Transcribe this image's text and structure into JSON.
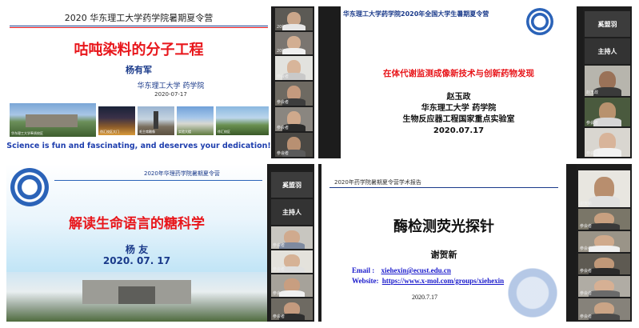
{
  "panel1": {
    "header": "2020 华东理工大学药学院暑期夏令营",
    "title": "咕吨染料的分子工程",
    "speaker": "杨有军",
    "affiliation": "华东理工大学    药学院",
    "date": "2020-07-17",
    "photos": [
      {
        "caption": "华东理工大学奉贤校区"
      },
      {
        "caption": "徐汇校区大门"
      },
      {
        "caption": "毛主席雕像"
      },
      {
        "caption": "实验大楼"
      },
      {
        "caption": "徐汇校区"
      }
    ],
    "motto": "Science is fun and fascinating, and deserves your dedication!",
    "participants": [
      {
        "name": "20级..."
      },
      {
        "name": "20级..."
      },
      {
        "name": "参会者"
      },
      {
        "name": "参会者"
      },
      {
        "name": "参会者"
      },
      {
        "name": "参会者"
      }
    ]
  },
  "panel2": {
    "header": "华东理工大学药学院2020年全国大学生暑期夏令营",
    "title": "在体代谢监测成像新技术与创新药物发现",
    "speaker": "赵玉政",
    "affiliation": "华东理工大学  药学院",
    "lab": "生物反应器工程国家重点实验室",
    "date": "2020.07.17",
    "name_tile": "奚盟羽",
    "host_label": "主持人",
    "participants": [
      {
        "name": "赵玉政"
      },
      {
        "name": "参会者"
      },
      {
        "name": "参会者"
      }
    ]
  },
  "panel3": {
    "header": "2020年华理药学院暑期夏令营",
    "title": "解读生命语言的糖科学",
    "speaker": "杨  友",
    "date": "2020. 07. 17",
    "name_tile": "奚盟羽",
    "host_label": "主持人",
    "participants": [
      {
        "name": "参会者"
      },
      {
        "name": "参会者"
      },
      {
        "name": "参会者"
      },
      {
        "name": "参会者"
      }
    ]
  },
  "panel4": {
    "header": "2020年药学院暑期夏令营学术报告",
    "title": "酶检测荧光探针",
    "speaker": "谢贺新",
    "email_label": "Email :",
    "email": "xiehexin@ecust.edu.cn",
    "website_label": "Website:",
    "website": "https://www.x-mol.com/groups/xiehexin",
    "date": "2020.7.17",
    "participants": [
      {
        "name": "谢贺新"
      },
      {
        "name": "参会者"
      },
      {
        "name": "参会者"
      },
      {
        "name": "参会者"
      },
      {
        "name": "参会者"
      },
      {
        "name": "参会者"
      }
    ]
  },
  "colors": {
    "accent_red": "#e8161b",
    "motto_blue": "#1f3fae",
    "header_blue": "#1a3a8a",
    "link_blue": "#1a1acc"
  }
}
